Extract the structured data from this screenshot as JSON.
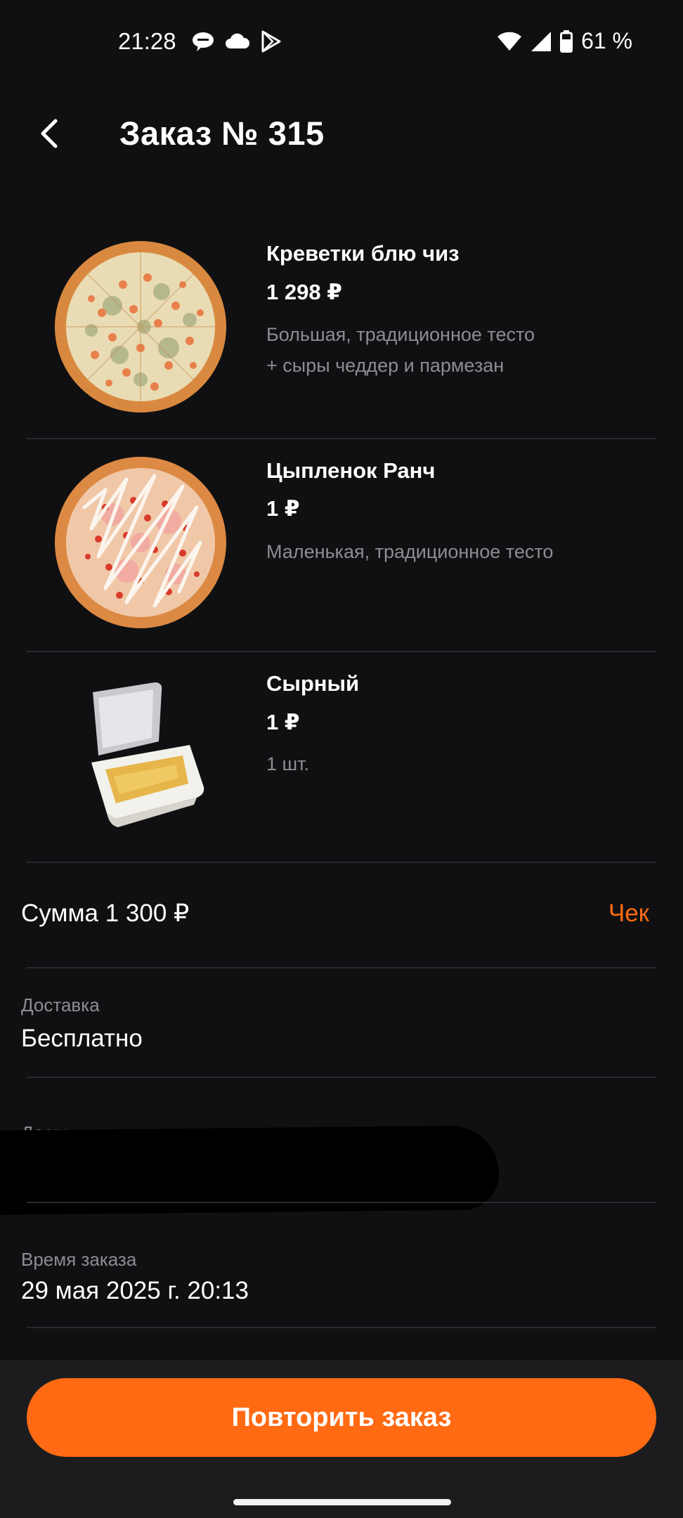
{
  "status_bar": {
    "time": "21:28",
    "battery": "61 %",
    "icons": [
      "cloud-chat-icon",
      "cloud-icon",
      "play-store-icon",
      "wifi-icon",
      "signal-icon",
      "battery-icon"
    ]
  },
  "header": {
    "title": "Заказ № 315",
    "back_icon": "chevron-left-icon"
  },
  "items": [
    {
      "name": "Креветки блю чиз",
      "price": "1 298 ₽",
      "description": "Большая, традиционное тесто\n+ сыры чеддер и пармезан",
      "image": "pizza-shrimp-blue-cheese"
    },
    {
      "name": "Цыпленок Ранч",
      "price": "1 ₽",
      "description": "Маленькая, традиционное тесто",
      "image": "pizza-chicken-ranch"
    },
    {
      "name": "Сырный",
      "price": "1 ₽",
      "description": "1 шт.",
      "image": "cheese-sauce-cup"
    }
  ],
  "summary": {
    "sum_text": "Сумма 1 300 ₽",
    "receipt_label": "Чек"
  },
  "delivery_cost": {
    "label": "Доставка",
    "value": "Бесплатно"
  },
  "delivery_address": {
    "label": "Доставка"
  },
  "order_time": {
    "label": "Время заказа",
    "value": "29 мая 2025 г. 20:13"
  },
  "actions": {
    "repeat_label": "Повторить заказ"
  },
  "colors": {
    "background": "#101012",
    "accent": "#ff6a13",
    "muted_text": "#8d8d92",
    "divider": "#2a2a2e"
  }
}
